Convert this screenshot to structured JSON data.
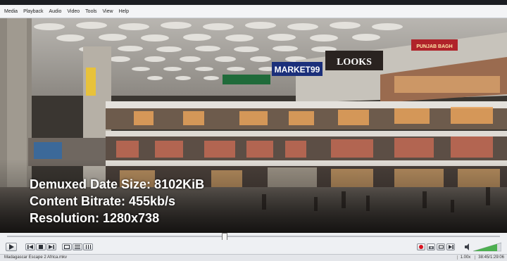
{
  "menu": [
    "Media",
    "Playback",
    "Audio",
    "Video",
    "Tools",
    "View",
    "Help"
  ],
  "video": {
    "store_signs": [
      "MARKET99",
      "LOOKS",
      "PUNJAB BAGH"
    ],
    "overlay_lines": [
      "Demuxed Date Size: 8102KiB",
      "Content Bitrate: 455kb/s",
      "Resolution: 1280x738"
    ]
  },
  "seek": {
    "progress": 0.44
  },
  "volume": {
    "level": 0.85
  },
  "status": {
    "filename": "Madagascar Escape 2 Africa.mkv",
    "speed": "1.00x",
    "time": "38:45/1:29:06"
  },
  "colors": {
    "record": "#d9121f",
    "volume_fill": "#4caf50"
  },
  "icons": [
    "play-icon",
    "previous-icon",
    "stop-icon",
    "next-icon",
    "fullscreen-icon",
    "playlist-icon",
    "extended-settings-icon",
    "record-icon",
    "snapshot-icon",
    "loop-icon",
    "frame-step-icon",
    "volume-icon"
  ]
}
